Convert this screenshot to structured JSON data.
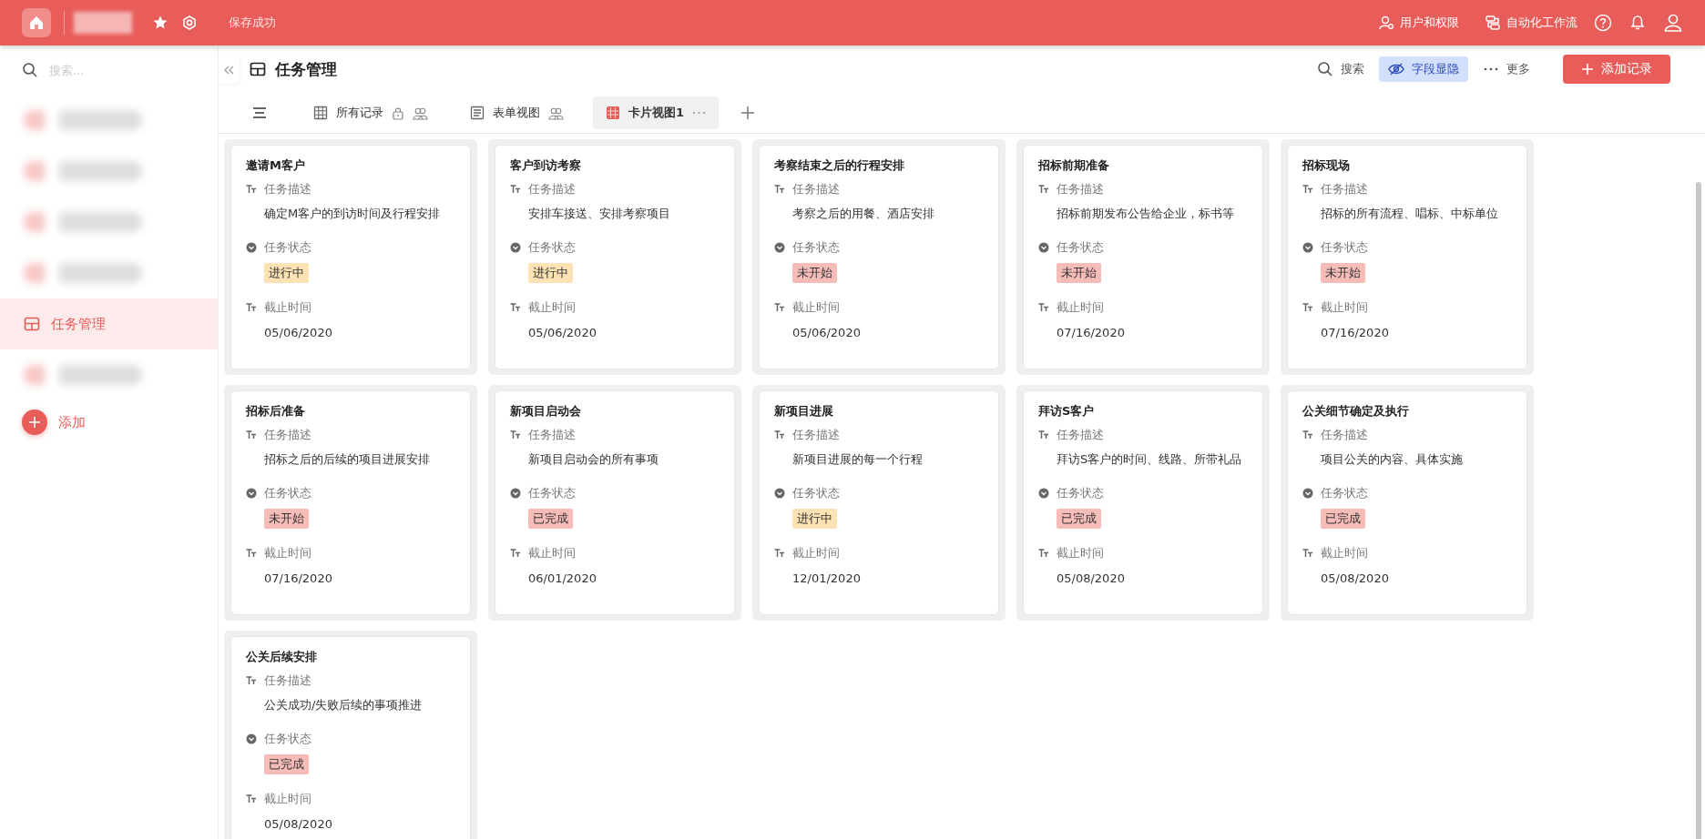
{
  "top_bar": {
    "status": "保存成功",
    "links": [
      {
        "kind": "users",
        "label": "用户和权限"
      },
      {
        "kind": "flow",
        "label": "自动化工作流"
      }
    ]
  },
  "sidebar": {
    "search": {
      "placeholder": "搜索..."
    },
    "items": [
      {
        "kind": "blurred",
        "selected": false
      },
      {
        "kind": "blurred",
        "selected": false
      },
      {
        "kind": "blurred",
        "selected": false
      },
      {
        "kind": "blurred",
        "selected": false
      },
      {
        "kind": "table",
        "label": "任务管理",
        "selected": true
      },
      {
        "kind": "blurred",
        "selected": false
      }
    ],
    "add": "添加"
  },
  "header": {
    "title": "任务管理",
    "actions": [
      {
        "kind": "search",
        "label": "搜索",
        "selected": false
      },
      {
        "kind": "eye",
        "label": "字段显隐",
        "selected": true
      },
      {
        "kind": "more",
        "label": "更多",
        "selected": false
      }
    ],
    "primary": "添加记录"
  },
  "tabs": [
    {
      "kind": "grid",
      "label": "所有记录",
      "lock": true,
      "selected": false
    },
    {
      "kind": "form",
      "label": "表单视图",
      "lock": false,
      "selected": false
    },
    {
      "kind": "card",
      "label": "卡片视图1",
      "lock": false,
      "selected": true
    }
  ],
  "cards": [
    {
      "title": "邀请M客户",
      "fields": [
        {
          "kind": "text",
          "label": "任务描述",
          "value": "确定M客户的到访时间及行程安排"
        },
        {
          "kind": "select",
          "label": "任务状态",
          "value": "进行中",
          "color": "#fde2b4"
        },
        {
          "kind": "text",
          "label": "截止时间",
          "value": "05/06/2020"
        }
      ]
    },
    {
      "title": "客户到访考察",
      "fields": [
        {
          "kind": "text",
          "label": "任务描述",
          "value": "安排车接送、安排考察项目"
        },
        {
          "kind": "select",
          "label": "任务状态",
          "value": "进行中",
          "color": "#fde2b4"
        },
        {
          "kind": "text",
          "label": "截止时间",
          "value": "05/06/2020"
        }
      ]
    },
    {
      "title": "考察结束之后的行程安排",
      "fields": [
        {
          "kind": "text",
          "label": "任务描述",
          "value": "考察之后的用餐、酒店安排"
        },
        {
          "kind": "select",
          "label": "任务状态",
          "value": "未开始",
          "color": "#f6bcb8"
        },
        {
          "kind": "text",
          "label": "截止时间",
          "value": "05/06/2020"
        }
      ]
    },
    {
      "title": "招标前期准备",
      "fields": [
        {
          "kind": "text",
          "label": "任务描述",
          "value": "招标前期发布公告给企业，标书等"
        },
        {
          "kind": "select",
          "label": "任务状态",
          "value": "未开始",
          "color": "#f6bcb8"
        },
        {
          "kind": "text",
          "label": "截止时间",
          "value": "07/16/2020"
        }
      ]
    },
    {
      "title": "招标现场",
      "fields": [
        {
          "kind": "text",
          "label": "任务描述",
          "value": "招标的所有流程、唱标、中标单位"
        },
        {
          "kind": "select",
          "label": "任务状态",
          "value": "未开始",
          "color": "#f6bcb8"
        },
        {
          "kind": "text",
          "label": "截止时间",
          "value": "07/16/2020"
        }
      ]
    },
    {
      "title": "招标后准备",
      "fields": [
        {
          "kind": "text",
          "label": "任务描述",
          "value": "招标之后的后续的项目进展安排"
        },
        {
          "kind": "select",
          "label": "任务状态",
          "value": "未开始",
          "color": "#f6bcb8"
        },
        {
          "kind": "text",
          "label": "截止时间",
          "value": "07/16/2020"
        }
      ]
    },
    {
      "title": "新项目启动会",
      "fields": [
        {
          "kind": "text",
          "label": "任务描述",
          "value": "新项目启动会的所有事项"
        },
        {
          "kind": "select",
          "label": "任务状态",
          "value": "已完成",
          "color": "#f6bcb8"
        },
        {
          "kind": "text",
          "label": "截止时间",
          "value": "06/01/2020"
        }
      ]
    },
    {
      "title": "新项目进展",
      "fields": [
        {
          "kind": "text",
          "label": "任务描述",
          "value": "新项目进展的每一个行程"
        },
        {
          "kind": "select",
          "label": "任务状态",
          "value": "进行中",
          "color": "#fde2b4"
        },
        {
          "kind": "text",
          "label": "截止时间",
          "value": "12/01/2020"
        }
      ]
    },
    {
      "title": "拜访S客户",
      "fields": [
        {
          "kind": "text",
          "label": "任务描述",
          "value": "拜访S客户的时间、线路、所带礼品"
        },
        {
          "kind": "select",
          "label": "任务状态",
          "value": "已完成",
          "color": "#f6bcb8"
        },
        {
          "kind": "text",
          "label": "截止时间",
          "value": "05/08/2020"
        }
      ]
    },
    {
      "title": "公关细节确定及执行",
      "fields": [
        {
          "kind": "text",
          "label": "任务描述",
          "value": "项目公关的内容、具体实施"
        },
        {
          "kind": "select",
          "label": "任务状态",
          "value": "已完成",
          "color": "#f6bcb8"
        },
        {
          "kind": "text",
          "label": "截止时间",
          "value": "05/08/2020"
        }
      ]
    },
    {
      "title": "公关后续安排",
      "fields": [
        {
          "kind": "text",
          "label": "任务描述",
          "value": "公关成功/失败后续的事项推进"
        },
        {
          "kind": "select",
          "label": "任务状态",
          "value": "已完成",
          "color": "#f6bcb8"
        },
        {
          "kind": "text",
          "label": "截止时间",
          "value": "05/08/2020"
        }
      ]
    }
  ]
}
